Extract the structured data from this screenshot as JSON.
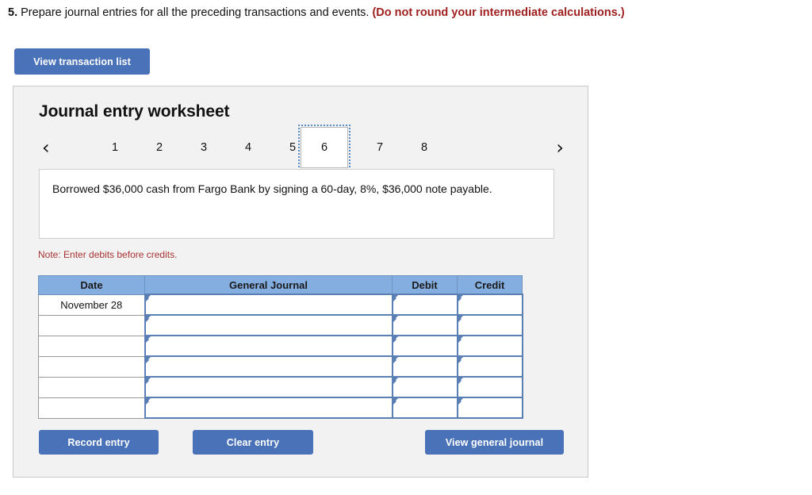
{
  "question": {
    "number": "5.",
    "text": "Prepare journal entries for all the preceding transactions and events.",
    "warning": "(Do not round your intermediate calculations.)"
  },
  "toolbar": {
    "view_transaction_list_label": "View transaction list"
  },
  "worksheet": {
    "title": "Journal entry worksheet",
    "nav": {
      "prev_icon": "chevron-left-icon",
      "next_icon": "chevron-right-icon",
      "prev_glyph": "‹",
      "next_glyph": "›"
    },
    "tabs": [
      {
        "label": "1",
        "selected": false
      },
      {
        "label": "2",
        "selected": false
      },
      {
        "label": "3",
        "selected": false
      },
      {
        "label": "4",
        "selected": false
      },
      {
        "label": "5",
        "selected": false
      },
      {
        "label": "6",
        "selected": true
      },
      {
        "label": "7",
        "selected": false
      },
      {
        "label": "8",
        "selected": false
      }
    ],
    "transaction_description": "Borrowed $36,000 cash from Fargo Bank by signing a 60-day, 8%, $36,000 note payable.",
    "note": "Note: Enter debits before credits.",
    "table": {
      "headers": [
        "Date",
        "General Journal",
        "Debit",
        "Credit"
      ],
      "rows": [
        {
          "date": "November 28",
          "general_journal": "",
          "debit": "",
          "credit": ""
        },
        {
          "date": "",
          "general_journal": "",
          "debit": "",
          "credit": ""
        },
        {
          "date": "",
          "general_journal": "",
          "debit": "",
          "credit": ""
        },
        {
          "date": "",
          "general_journal": "",
          "debit": "",
          "credit": ""
        },
        {
          "date": "",
          "general_journal": "",
          "debit": "",
          "credit": ""
        },
        {
          "date": "",
          "general_journal": "",
          "debit": "",
          "credit": ""
        }
      ]
    },
    "buttons": {
      "record_entry": "Record entry",
      "clear_entry": "Clear entry",
      "view_general_journal": "View general journal"
    }
  },
  "colors": {
    "button_blue": "#4a72b8",
    "header_blue": "#85aee0",
    "cell_border_blue": "#5a7fb5",
    "warning_red": "#a02020",
    "note_red": "#a83232",
    "panel_bg": "#f2f2f2"
  }
}
